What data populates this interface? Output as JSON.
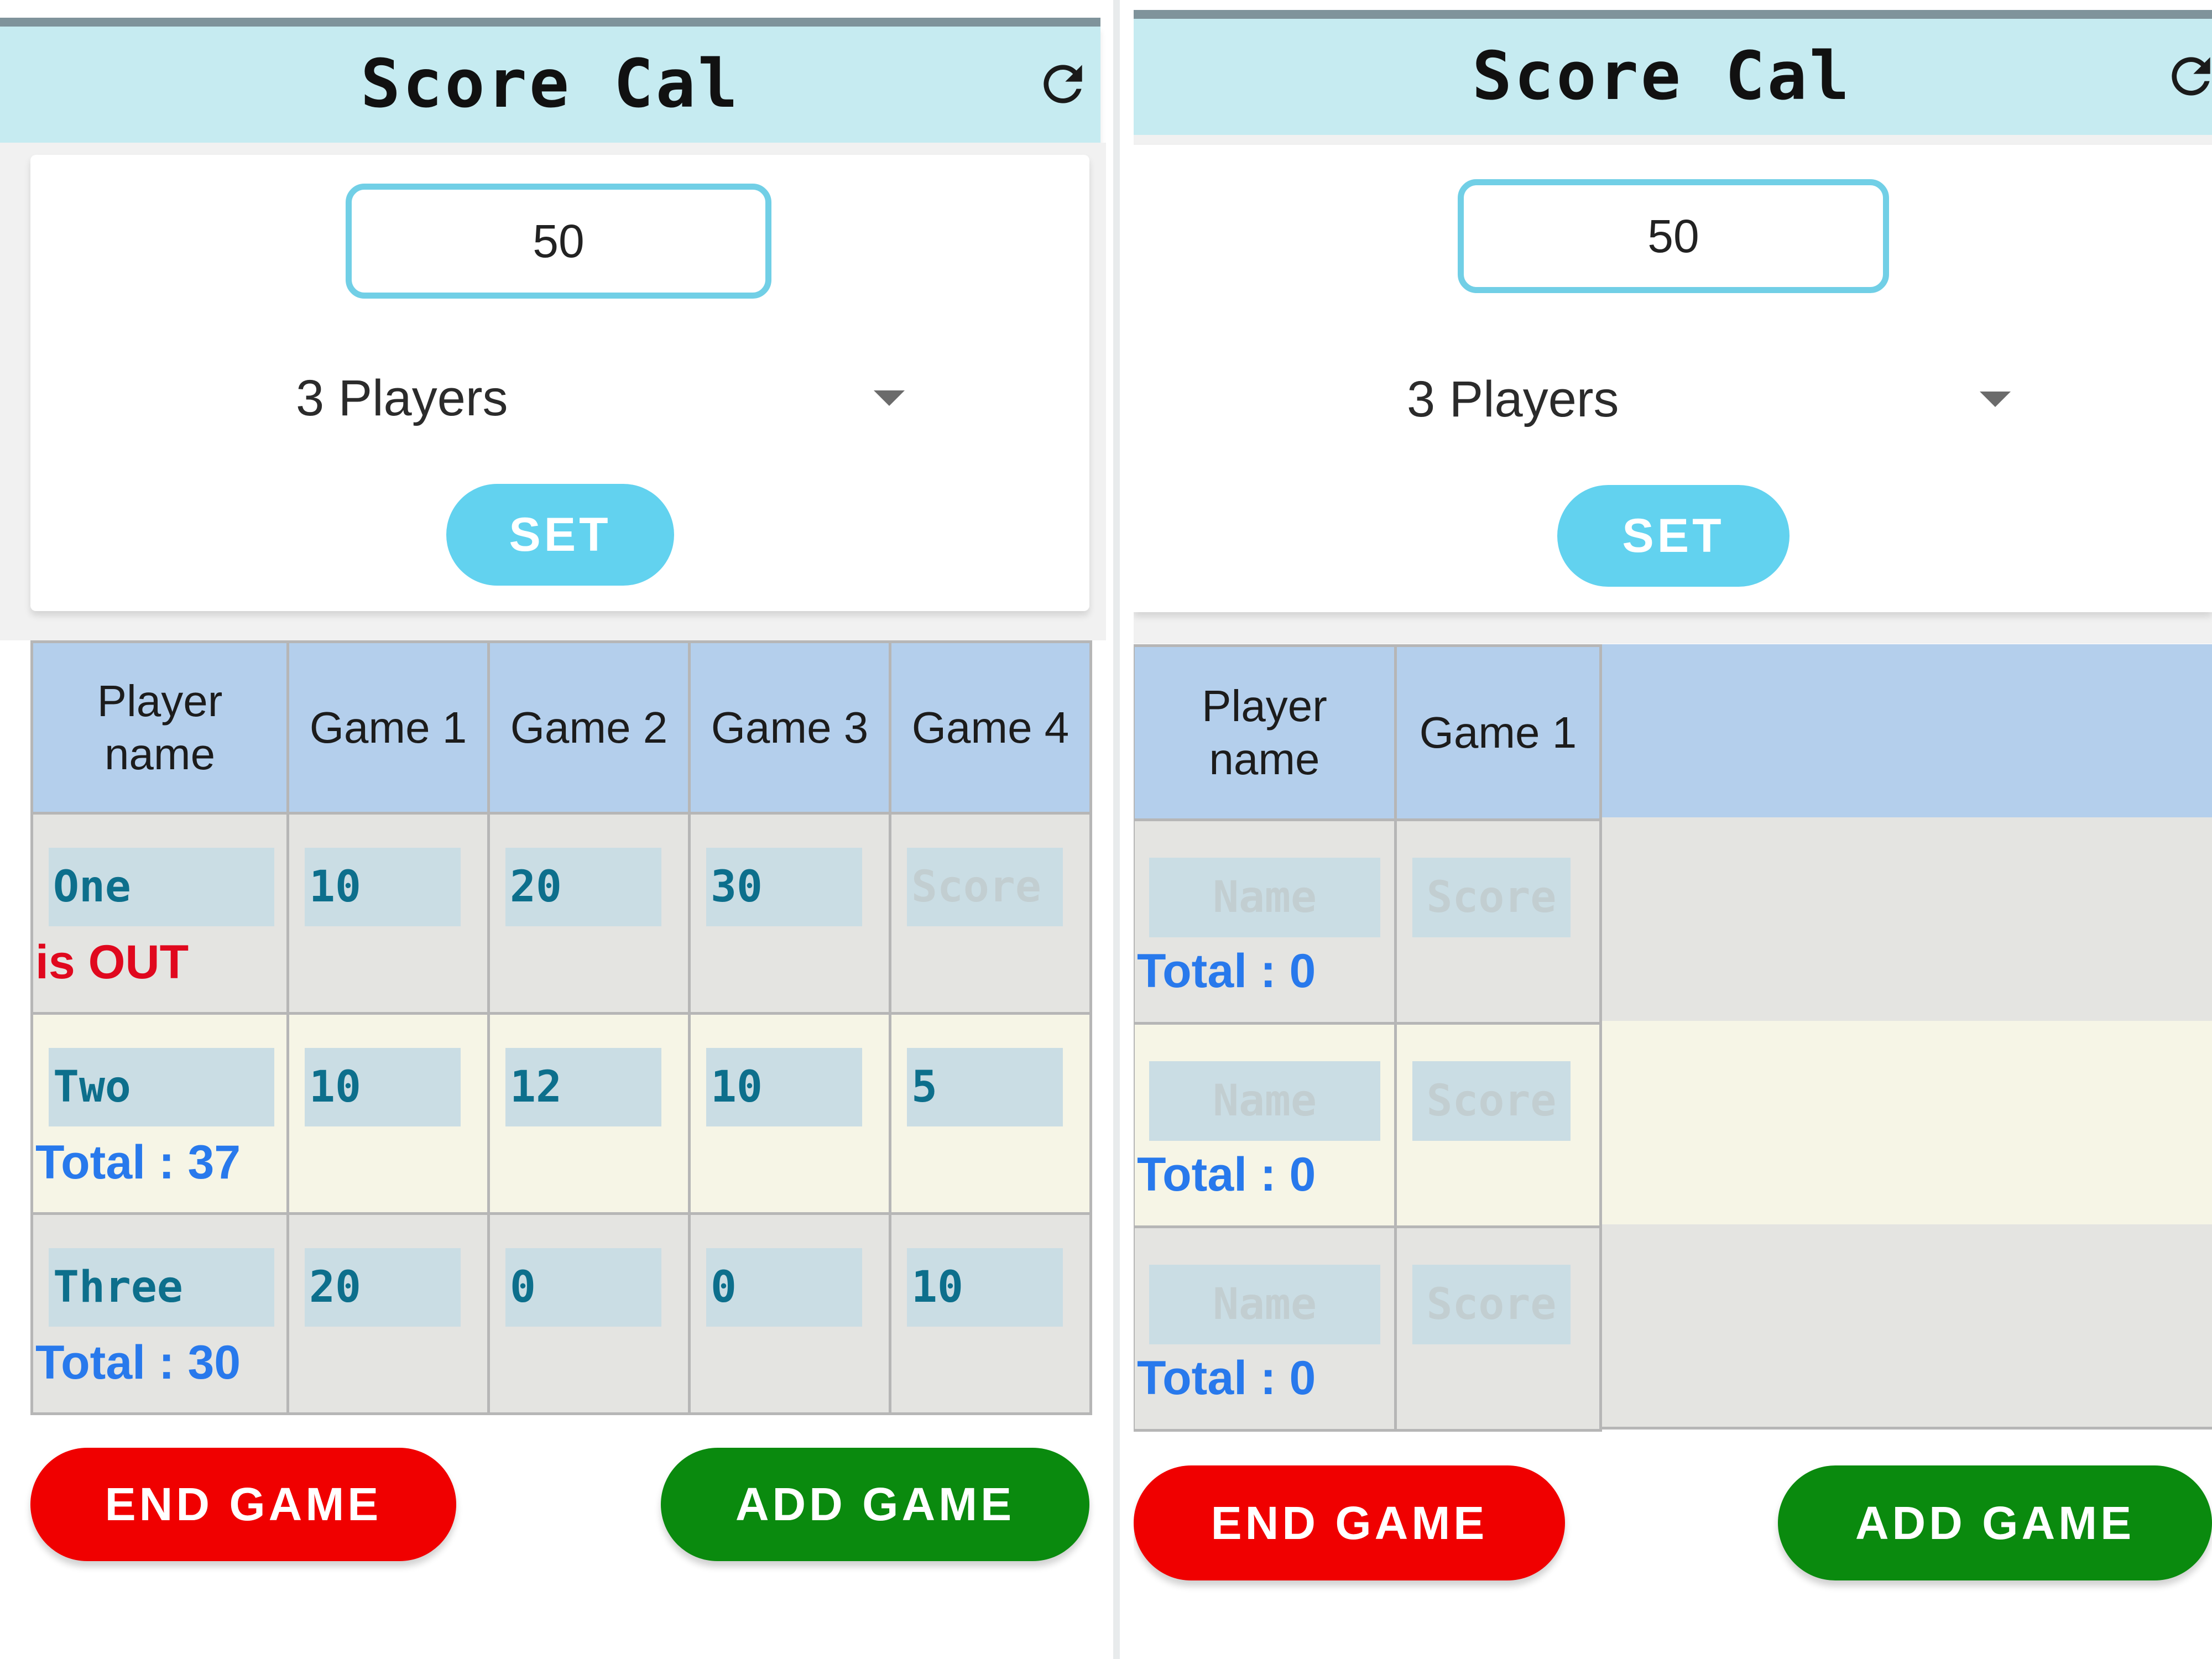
{
  "screens": [
    {
      "app_title": "Score Cal",
      "target_value": "50",
      "players_selected": "3 Players",
      "set_label": "SET",
      "columns": [
        "Player\nname",
        "Game 1",
        "Game 2",
        "Game 3",
        "Game 4"
      ],
      "rows": [
        {
          "name": "One",
          "scores": [
            "10",
            "20",
            "30",
            ""
          ],
          "status": "is OUT",
          "status_type": "out"
        },
        {
          "name": "Two",
          "scores": [
            "10",
            "12",
            "10",
            "5"
          ],
          "status": "Total : 37",
          "status_type": "total"
        },
        {
          "name": "Three",
          "scores": [
            "20",
            "0",
            "0",
            "10"
          ],
          "status": "Total : 30",
          "status_type": "total"
        }
      ],
      "name_placeholder": "Name",
      "score_placeholder": "Score",
      "end_label": "END GAME",
      "add_label": "ADD GAME"
    },
    {
      "app_title": "Score Cal",
      "target_value": "50",
      "players_selected": "3 Players",
      "set_label": "SET",
      "columns": [
        "Player\nname",
        "Game 1"
      ],
      "rows": [
        {
          "name": "",
          "scores": [
            ""
          ],
          "status": "Total : 0",
          "status_type": "total"
        },
        {
          "name": "",
          "scores": [
            ""
          ],
          "status": "Total : 0",
          "status_type": "total"
        },
        {
          "name": "",
          "scores": [
            ""
          ],
          "status": "Total : 0",
          "status_type": "total"
        }
      ],
      "name_placeholder": "Name",
      "score_placeholder": "Score",
      "end_label": "END GAME",
      "add_label": "ADD GAME"
    }
  ],
  "icons": {
    "refresh": "refresh-icon",
    "dropdown": "chevron-down-icon"
  },
  "colors": {
    "appbar": "#c6ebf1",
    "accent": "#62d2ef",
    "end": "#f00000",
    "add": "#0a8a0e",
    "header": "#b4cfec",
    "out": "#e0081e",
    "total": "#2879ec"
  }
}
